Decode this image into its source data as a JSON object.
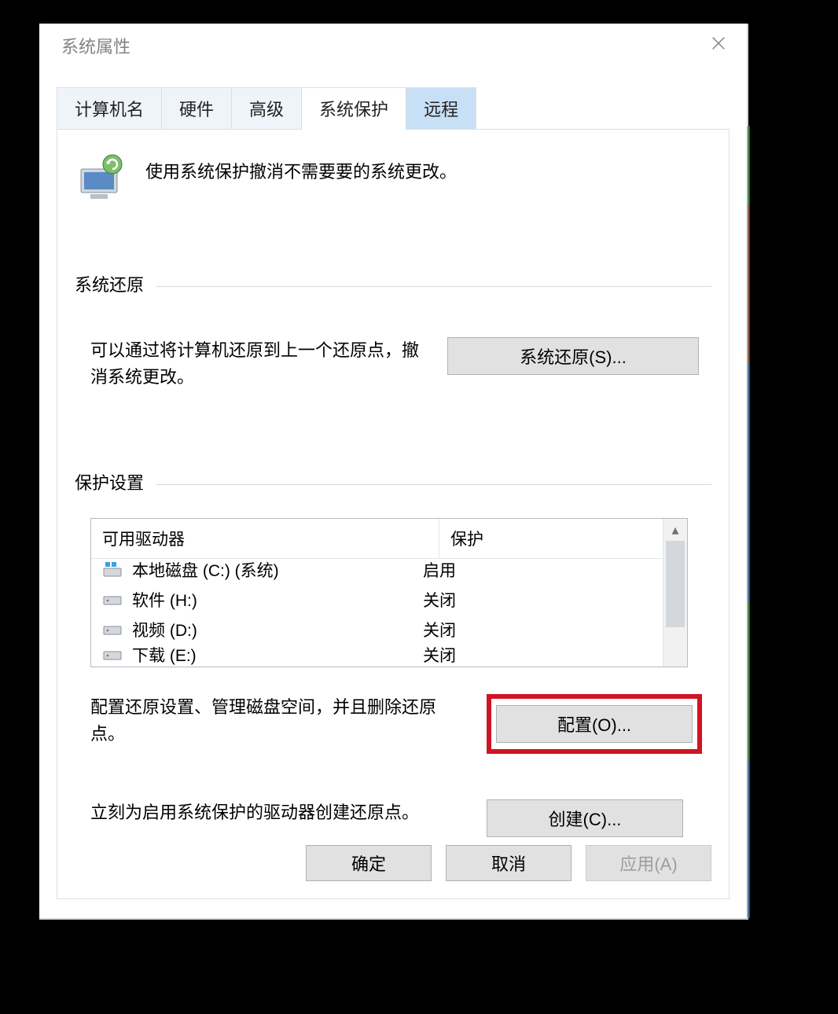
{
  "window": {
    "title": "系统属性"
  },
  "tabs": [
    "计算机名",
    "硬件",
    "高级",
    "系统保护",
    "远程"
  ],
  "active_tab_index": 3,
  "intro_text": "使用系统保护撤消不需要要的系统更改。",
  "restore": {
    "section_title": "系统还原",
    "description": "可以通过将计算机还原到上一个还原点，撤消系统更改。",
    "button_label": "系统还原(S)..."
  },
  "protection": {
    "section_title": "保护设置",
    "columns": [
      "可用驱动器",
      "保护"
    ],
    "drives": [
      {
        "icon": "system-disk",
        "name": "本地磁盘 (C:) (系统)",
        "status": "启用"
      },
      {
        "icon": "disk",
        "name": "软件 (H:)",
        "status": "关闭"
      },
      {
        "icon": "disk",
        "name": "视频 (D:)",
        "status": "关闭"
      },
      {
        "icon": "disk",
        "name": "下载 (E:)",
        "status": "关闭"
      }
    ],
    "configure_text": "配置还原设置、管理磁盘空间，并且删除还原点。",
    "configure_button": "配置(O)...",
    "create_text": "立刻为启用系统保护的驱动器创建还原点。",
    "create_button": "创建(C)..."
  },
  "dialog_buttons": {
    "ok": "确定",
    "cancel": "取消",
    "apply": "应用(A)"
  }
}
